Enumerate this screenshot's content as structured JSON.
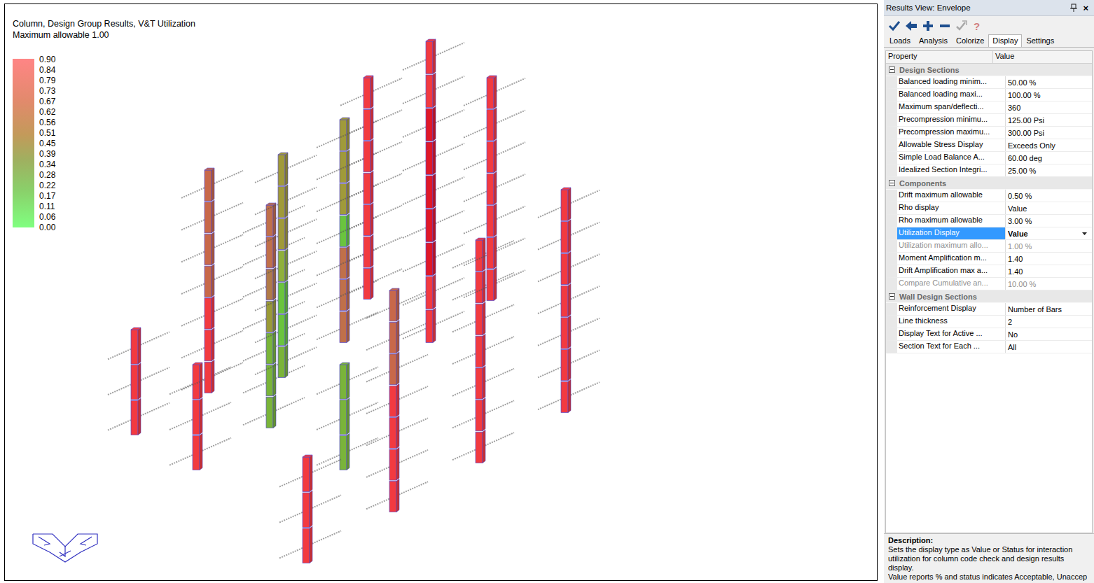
{
  "canvas": {
    "title": "Column, Design Group Results, V&T Utilization",
    "subtitle": "Maximum allowable 1.00",
    "legend": [
      "0.90",
      "0.84",
      "0.79",
      "0.73",
      "0.67",
      "0.62",
      "0.56",
      "0.51",
      "0.45",
      "0.39",
      "0.34",
      "0.28",
      "0.22",
      "0.17",
      "0.11",
      "0.06",
      "0.00"
    ],
    "columns": [
      {
        "segments": [
          {
            "color": "#f23a40"
          },
          {
            "color": "#f23a40"
          },
          {
            "color": "#f23a40"
          }
        ]
      },
      {
        "segments": [
          {
            "color": "#f23a40"
          },
          {
            "color": "#f23a40"
          },
          {
            "color": "#f23a40"
          }
        ]
      },
      {
        "segments": [
          {
            "color": "#c8684a"
          },
          {
            "color": "#c8684a"
          },
          {
            "color": "#c8684a"
          },
          {
            "color": "#c8684a"
          },
          {
            "color": "#f23a40"
          },
          {
            "color": "#f23a40"
          },
          {
            "color": "#f23a40"
          }
        ]
      },
      {
        "segments": [
          {
            "color": "#c0704a"
          },
          {
            "color": "#c0704a"
          },
          {
            "color": "#b07a48"
          },
          {
            "color": "#9a9a38"
          },
          {
            "color": "#7ab43a"
          },
          {
            "color": "#7ab43a"
          },
          {
            "color": "#7ab43a"
          }
        ]
      },
      {
        "segments": [
          {
            "color": "#a09a3a"
          },
          {
            "color": "#a09a3a"
          },
          {
            "color": "#a09a3a"
          },
          {
            "color": "#8fb03c"
          },
          {
            "color": "#6ac43e"
          },
          {
            "color": "#6ac43e"
          },
          {
            "color": "#7ab43a"
          }
        ]
      },
      {
        "segments": [
          {
            "color": "#a09a3a"
          },
          {
            "color": "#a09a3a"
          },
          {
            "color": "#a09a3a"
          },
          {
            "color": "#6ac43e"
          },
          {
            "color": "#c0704a"
          },
          {
            "color": "#c0704a"
          },
          {
            "color": "#c0704a"
          }
        ]
      },
      {
        "segments": [
          {
            "color": "#7ab43a"
          },
          {
            "color": "#7ab43a"
          },
          {
            "color": "#7ab43a"
          }
        ]
      },
      {
        "segments": [
          {
            "color": "#f23a40"
          },
          {
            "color": "#f23a40"
          },
          {
            "color": "#f23a40"
          },
          {
            "color": "#f23a40"
          },
          {
            "color": "#f23a40"
          },
          {
            "color": "#f23a40"
          },
          {
            "color": "#f23a40"
          }
        ]
      },
      {
        "segments": [
          {
            "color": "#f23a40"
          },
          {
            "color": "#f23a40"
          },
          {
            "color": "#f23a40"
          }
        ]
      },
      {
        "segments": [
          {
            "color": "#c8684a"
          },
          {
            "color": "#c8684a"
          },
          {
            "color": "#c8684a"
          },
          {
            "color": "#f23a40"
          },
          {
            "color": "#f23a40"
          },
          {
            "color": "#f23a40"
          },
          {
            "color": "#f23a40"
          }
        ]
      },
      {
        "segments": [
          {
            "color": "#f23a40"
          },
          {
            "color": "#f23a40"
          },
          {
            "color": "#e01828"
          },
          {
            "color": "#e01828"
          },
          {
            "color": "#e01828"
          },
          {
            "color": "#e01828"
          },
          {
            "color": "#e01828"
          },
          {
            "color": "#f23a40"
          },
          {
            "color": "#f23a40"
          }
        ]
      },
      {
        "segments": [
          {
            "color": "#f23a40"
          },
          {
            "color": "#f23a40"
          },
          {
            "color": "#f23a40"
          },
          {
            "color": "#f23a40"
          },
          {
            "color": "#f23a40"
          },
          {
            "color": "#f23a40"
          },
          {
            "color": "#f23a40"
          }
        ]
      },
      {
        "segments": [
          {
            "color": "#f23a40"
          },
          {
            "color": "#f23a40"
          },
          {
            "color": "#f23a40"
          },
          {
            "color": "#f23a40"
          },
          {
            "color": "#f23a40"
          },
          {
            "color": "#f23a40"
          },
          {
            "color": "#f23a40"
          }
        ]
      },
      {
        "segments": [
          {
            "color": "#f23a40"
          },
          {
            "color": "#f23a40"
          },
          {
            "color": "#f23a40"
          },
          {
            "color": "#f23a40"
          },
          {
            "color": "#f23a40"
          },
          {
            "color": "#f23a40"
          },
          {
            "color": "#f23a40"
          }
        ]
      }
    ]
  },
  "panel": {
    "title": "Results View: Envelope",
    "close": "×",
    "help": "?",
    "tabs": [
      {
        "label": "Loads",
        "selected": false
      },
      {
        "label": "Analysis",
        "selected": false
      },
      {
        "label": "Colorize",
        "selected": false
      },
      {
        "label": "Display",
        "selected": true
      },
      {
        "label": "Settings",
        "selected": false
      }
    ],
    "headers": [
      "Property",
      "Value"
    ],
    "sections": [
      {
        "name": "Design Sections",
        "expanded": true,
        "rows": [
          {
            "name": "Balanced loading minim...",
            "value": "50.00 %",
            "selected": false,
            "disabled": false
          },
          {
            "name": "Balanced loading maxi...",
            "value": "100.00 %",
            "selected": false,
            "disabled": false
          },
          {
            "name": "Maximum span/deflecti...",
            "value": "360",
            "selected": false,
            "disabled": false
          },
          {
            "name": "Precompression minimu...",
            "value": "125.00 Psi",
            "selected": false,
            "disabled": false
          },
          {
            "name": "Precompression maximu...",
            "value": "300.00 Psi",
            "selected": false,
            "disabled": false
          },
          {
            "name": "Allowable Stress Display",
            "value": "Exceeds Only",
            "selected": false,
            "disabled": false
          },
          {
            "name": "Simple Load Balance A...",
            "value": "60.00 deg",
            "selected": false,
            "disabled": false
          },
          {
            "name": "Idealized Section Integri...",
            "value": "25.00 %",
            "selected": false,
            "disabled": false
          }
        ]
      },
      {
        "name": "Components",
        "expanded": true,
        "rows": [
          {
            "name": "Drift maximum allowable",
            "value": "0.50 %",
            "selected": false,
            "disabled": false
          },
          {
            "name": "Rho display",
            "value": "Value",
            "selected": false,
            "disabled": false
          },
          {
            "name": "Rho maximum allowable",
            "value": "3.00 %",
            "selected": false,
            "disabled": false
          },
          {
            "name": "Utilization Display",
            "value": "Value",
            "selected": true,
            "disabled": false
          },
          {
            "name": "Utilization maximum allo...",
            "value": "1.00 %",
            "selected": false,
            "disabled": true
          },
          {
            "name": "Moment Amplification m...",
            "value": "1.40",
            "selected": false,
            "disabled": false
          },
          {
            "name": "Drift Amplification max a...",
            "value": "1.40",
            "selected": false,
            "disabled": false
          },
          {
            "name": "Compare Cumulative an...",
            "value": "10.00 %",
            "selected": false,
            "disabled": true
          }
        ]
      },
      {
        "name": "Wall Design Sections",
        "expanded": true,
        "rows": [
          {
            "name": "Reinforcement Display",
            "value": "Number of Bars",
            "selected": false,
            "disabled": false
          },
          {
            "name": "Line thickness",
            "value": "2",
            "selected": false,
            "disabled": false
          },
          {
            "name": "Display Text for Active ...",
            "value": "No",
            "selected": false,
            "disabled": false
          },
          {
            "name": "Section Text for Each ...",
            "value": "All",
            "selected": false,
            "disabled": false
          }
        ]
      }
    ],
    "description": {
      "heading": "Description:",
      "text": "Sets the display type as Value or Status for interaction utilization for column code check and design results display.",
      "more": "Value reports % and status indicates Acceptable, Unaccep"
    }
  }
}
